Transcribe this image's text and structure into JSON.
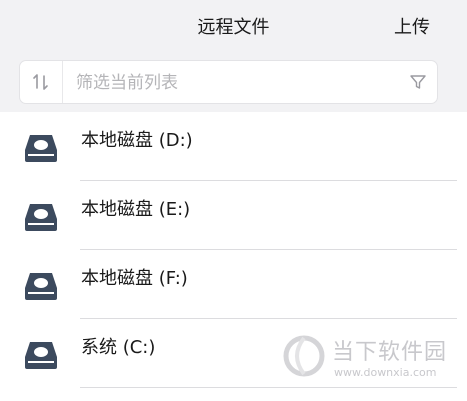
{
  "header": {
    "title": "远程文件",
    "upload_label": "上传"
  },
  "filter": {
    "placeholder": "筛选当前列表",
    "value": "",
    "sort_icon": "sort-arrows-icon",
    "filter_icon": "funnel-icon"
  },
  "drives": [
    {
      "label": "本地磁盘 (D:)",
      "icon": "hard-disk-icon"
    },
    {
      "label": "本地磁盘 (E:)",
      "icon": "hard-disk-icon"
    },
    {
      "label": "本地磁盘 (F:)",
      "icon": "hard-disk-icon"
    },
    {
      "label": "系统 (C:)",
      "icon": "hard-disk-icon"
    }
  ],
  "watermark": {
    "name": "当下软件园",
    "url": "www.downxia.com"
  },
  "colors": {
    "background": "#f2f2f4",
    "disk_icon": "#3c4a5e",
    "text": "#1a1a1a",
    "placeholder": "#b5b5b8"
  }
}
